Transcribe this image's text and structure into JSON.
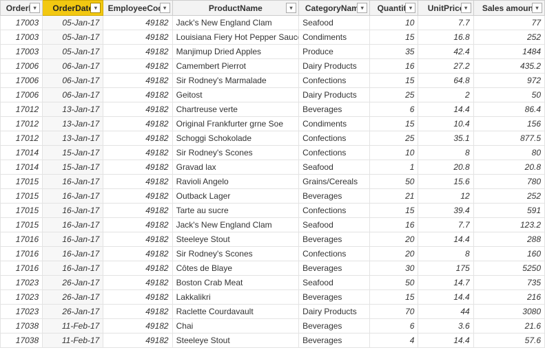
{
  "columns": [
    {
      "key": "orderId",
      "label": "OrderID",
      "hclass": "col-orderid",
      "active": false,
      "cell": "num"
    },
    {
      "key": "orderDate",
      "label": "OrderDate",
      "hclass": "col-date",
      "active": true,
      "cell": "date"
    },
    {
      "key": "empCode",
      "label": "EmployeeCode",
      "hclass": "col-emp",
      "active": false,
      "cell": "num"
    },
    {
      "key": "product",
      "label": "ProductName",
      "hclass": "col-product",
      "active": false,
      "cell": "str"
    },
    {
      "key": "category",
      "label": "CategoryName",
      "hclass": "col-cat",
      "active": false,
      "cell": "str"
    },
    {
      "key": "qty",
      "label": "Quantity",
      "hclass": "col-qty",
      "active": false,
      "cell": "num"
    },
    {
      "key": "price",
      "label": "UnitPrice",
      "hclass": "col-price",
      "active": false,
      "cell": "num"
    },
    {
      "key": "sales",
      "label": "Sales amount",
      "hclass": "col-sales",
      "active": false,
      "cell": "num"
    }
  ],
  "rows": [
    {
      "orderId": "17003",
      "orderDate": "05-Jan-17",
      "empCode": "49182",
      "product": "Jack's New England Clam",
      "category": "Seafood",
      "qty": "10",
      "price": "7.7",
      "sales": "77"
    },
    {
      "orderId": "17003",
      "orderDate": "05-Jan-17",
      "empCode": "49182",
      "product": "Louisiana Fiery Hot Pepper Sauce",
      "category": "Condiments",
      "qty": "15",
      "price": "16.8",
      "sales": "252"
    },
    {
      "orderId": "17003",
      "orderDate": "05-Jan-17",
      "empCode": "49182",
      "product": "Manjimup Dried Apples",
      "category": "Produce",
      "qty": "35",
      "price": "42.4",
      "sales": "1484"
    },
    {
      "orderId": "17006",
      "orderDate": "06-Jan-17",
      "empCode": "49182",
      "product": "Camembert Pierrot",
      "category": "Dairy Products",
      "qty": "16",
      "price": "27.2",
      "sales": "435.2"
    },
    {
      "orderId": "17006",
      "orderDate": "06-Jan-17",
      "empCode": "49182",
      "product": "Sir Rodney's Marmalade",
      "category": "Confections",
      "qty": "15",
      "price": "64.8",
      "sales": "972"
    },
    {
      "orderId": "17006",
      "orderDate": "06-Jan-17",
      "empCode": "49182",
      "product": "Geitost",
      "category": "Dairy Products",
      "qty": "25",
      "price": "2",
      "sales": "50"
    },
    {
      "orderId": "17012",
      "orderDate": "13-Jan-17",
      "empCode": "49182",
      "product": "Chartreuse verte",
      "category": "Beverages",
      "qty": "6",
      "price": "14.4",
      "sales": "86.4"
    },
    {
      "orderId": "17012",
      "orderDate": "13-Jan-17",
      "empCode": "49182",
      "product": "Original Frankfurter grne Soe",
      "category": "Condiments",
      "qty": "15",
      "price": "10.4",
      "sales": "156"
    },
    {
      "orderId": "17012",
      "orderDate": "13-Jan-17",
      "empCode": "49182",
      "product": "Schoggi Schokolade",
      "category": "Confections",
      "qty": "25",
      "price": "35.1",
      "sales": "877.5"
    },
    {
      "orderId": "17014",
      "orderDate": "15-Jan-17",
      "empCode": "49182",
      "product": "Sir Rodney's Scones",
      "category": "Confections",
      "qty": "10",
      "price": "8",
      "sales": "80"
    },
    {
      "orderId": "17014",
      "orderDate": "15-Jan-17",
      "empCode": "49182",
      "product": "Gravad lax",
      "category": "Seafood",
      "qty": "1",
      "price": "20.8",
      "sales": "20.8"
    },
    {
      "orderId": "17015",
      "orderDate": "16-Jan-17",
      "empCode": "49182",
      "product": "Ravioli Angelo",
      "category": "Grains/Cereals",
      "qty": "50",
      "price": "15.6",
      "sales": "780"
    },
    {
      "orderId": "17015",
      "orderDate": "16-Jan-17",
      "empCode": "49182",
      "product": "Outback Lager",
      "category": "Beverages",
      "qty": "21",
      "price": "12",
      "sales": "252"
    },
    {
      "orderId": "17015",
      "orderDate": "16-Jan-17",
      "empCode": "49182",
      "product": "Tarte au sucre",
      "category": "Confections",
      "qty": "15",
      "price": "39.4",
      "sales": "591"
    },
    {
      "orderId": "17015",
      "orderDate": "16-Jan-17",
      "empCode": "49182",
      "product": "Jack's New England Clam",
      "category": "Seafood",
      "qty": "16",
      "price": "7.7",
      "sales": "123.2"
    },
    {
      "orderId": "17016",
      "orderDate": "16-Jan-17",
      "empCode": "49182",
      "product": "Steeleye Stout",
      "category": "Beverages",
      "qty": "20",
      "price": "14.4",
      "sales": "288"
    },
    {
      "orderId": "17016",
      "orderDate": "16-Jan-17",
      "empCode": "49182",
      "product": "Sir Rodney's Scones",
      "category": "Confections",
      "qty": "20",
      "price": "8",
      "sales": "160"
    },
    {
      "orderId": "17016",
      "orderDate": "16-Jan-17",
      "empCode": "49182",
      "product": "Côtes de Blaye",
      "category": "Beverages",
      "qty": "30",
      "price": "175",
      "sales": "5250"
    },
    {
      "orderId": "17023",
      "orderDate": "26-Jan-17",
      "empCode": "49182",
      "product": "Boston Crab Meat",
      "category": "Seafood",
      "qty": "50",
      "price": "14.7",
      "sales": "735"
    },
    {
      "orderId": "17023",
      "orderDate": "26-Jan-17",
      "empCode": "49182",
      "product": "Lakkalikri",
      "category": "Beverages",
      "qty": "15",
      "price": "14.4",
      "sales": "216"
    },
    {
      "orderId": "17023",
      "orderDate": "26-Jan-17",
      "empCode": "49182",
      "product": "Raclette Courdavault",
      "category": "Dairy Products",
      "qty": "70",
      "price": "44",
      "sales": "3080"
    },
    {
      "orderId": "17038",
      "orderDate": "11-Feb-17",
      "empCode": "49182",
      "product": "Chai",
      "category": "Beverages",
      "qty": "6",
      "price": "3.6",
      "sales": "21.6"
    },
    {
      "orderId": "17038",
      "orderDate": "11-Feb-17",
      "empCode": "49182",
      "product": "Steeleye Stout",
      "category": "Beverages",
      "qty": "4",
      "price": "14.4",
      "sales": "57.6"
    }
  ]
}
